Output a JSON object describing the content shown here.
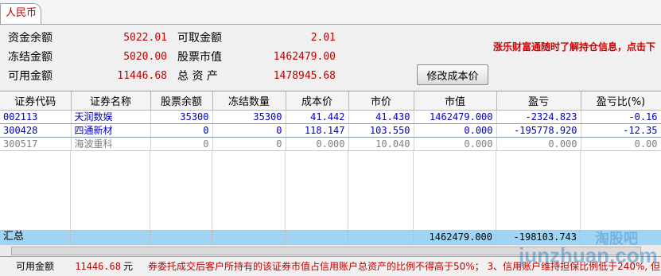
{
  "tab": {
    "label": "人民币"
  },
  "summary": {
    "fund_balance": {
      "label": "资金余额",
      "value": "5022.01"
    },
    "frozen_amount": {
      "label": "冻结金额",
      "value": "5020.00"
    },
    "available_amount": {
      "label": "可用金额",
      "value": "11446.68"
    },
    "withdrawable_amount": {
      "label": "可取金额",
      "value": "2.01"
    },
    "stock_market_value": {
      "label": "股票市值",
      "value": "1462479.00"
    },
    "total_assets": {
      "label": "总 资 产",
      "value": "1478945.68"
    }
  },
  "modify_cost_button": {
    "label": "修改成本价"
  },
  "notice": {
    "text": "涨乐财富通随时了解持仓信息，点击下"
  },
  "table": {
    "headers": [
      "证券代码",
      "证券名称",
      "股票余额",
      "冻结数量",
      "成本价",
      "市价",
      "市值",
      "盈亏",
      "盈亏比(%)"
    ],
    "rows": [
      [
        "002113",
        "天润数娱",
        "35300",
        "35300",
        "41.442",
        "41.430",
        "1462479.000",
        "-2324.823",
        "-0.16"
      ],
      [
        "300428",
        "四通新材",
        "0",
        "0",
        "118.147",
        "103.550",
        "0.000",
        "-195778.920",
        "-12.35"
      ],
      [
        "300517",
        "海波重科",
        "0",
        "0",
        "0.000",
        "10.040",
        "0.000",
        "0.000",
        "0.00"
      ]
    ],
    "total": {
      "label": "汇总",
      "market_value": "1462479.000",
      "profit_loss": "-198103.743"
    }
  },
  "status_bar": {
    "available_label": "可用金额",
    "available_value": "11446.68",
    "unit": "元",
    "message": "券委托成交后客户所持有的该证券市值占信用账户总资产的比例不得高于50%； 3、信用账户维持担保比例低于240%, 但不"
  },
  "watermark": {
    "text": "junzhuan.com",
    "text2": "淘股吧"
  },
  "colors": {
    "accent_red": "#c00000",
    "row_blue": "#0000c8",
    "total_row": "#9fd4f4"
  }
}
